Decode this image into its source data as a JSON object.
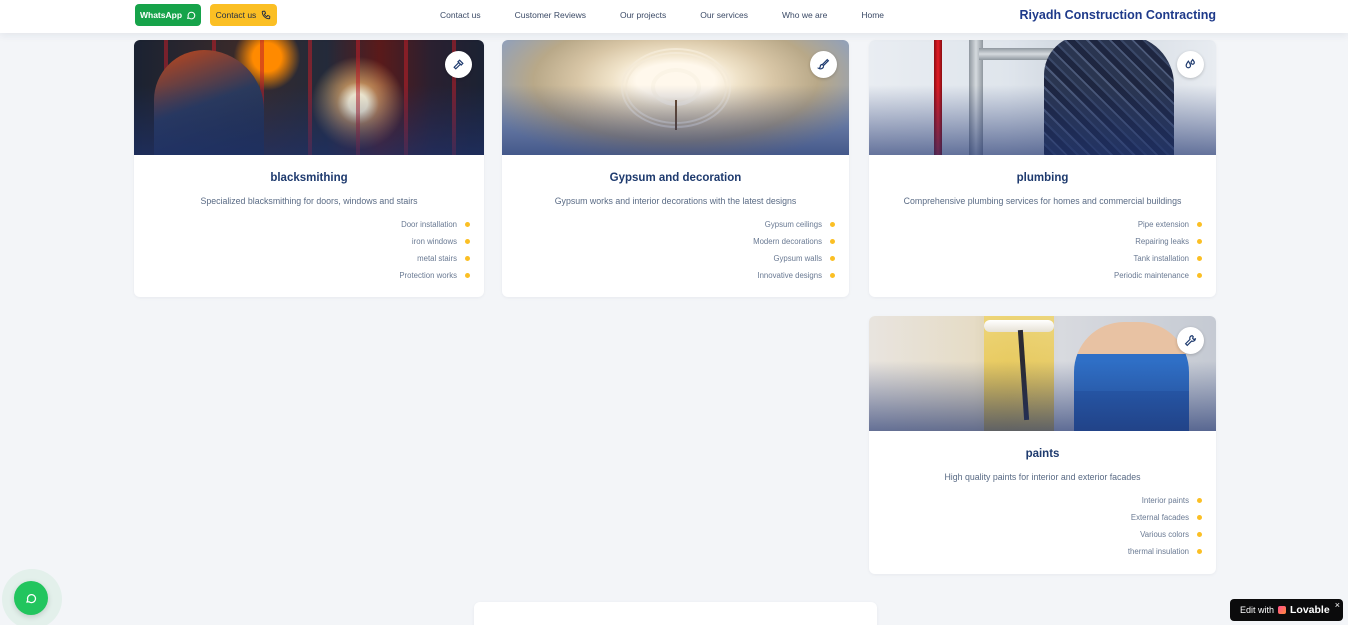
{
  "header": {
    "whatsapp_label": "WhatsApp",
    "contact_label": "Contact us",
    "nav": [
      "Contact us",
      "Customer Reviews",
      "Our projects",
      "Our services",
      "Who we are",
      "Home"
    ],
    "brand": "Riyadh Construction Contracting"
  },
  "cards": [
    {
      "title": "blacksmithing",
      "description": "Specialized blacksmithing for doors, windows and stairs",
      "icon": "hammer-icon",
      "items": [
        "Door installation",
        "iron windows",
        "metal stairs",
        "Protection works"
      ]
    },
    {
      "title": "Gypsum and decoration",
      "description": "Gypsum works and interior decorations with the latest designs",
      "icon": "paintbrush-icon",
      "items": [
        "Gypsum ceilings",
        "Modern decorations",
        "Gypsum walls",
        "Innovative designs"
      ]
    },
    {
      "title": "plumbing",
      "description": "Comprehensive plumbing services for homes and commercial buildings",
      "icon": "droplets-icon",
      "items": [
        "Pipe extension",
        "Repairing leaks",
        "Tank installation",
        "Periodic maintenance"
      ]
    },
    {
      "title": "paints",
      "description": "High quality paints for interior and exterior facades",
      "icon": "wrench-icon",
      "items": [
        "Interior paints",
        "External facades",
        "Various colors",
        "thermal insulation"
      ]
    }
  ],
  "badge": {
    "edit_with": "Edit with",
    "brand": "Lovable",
    "close": "×"
  },
  "colors": {
    "primary": "#1e3a8a",
    "accent": "#fbbf24",
    "whatsapp": "#16a34a",
    "background": "#f3f5f8"
  }
}
